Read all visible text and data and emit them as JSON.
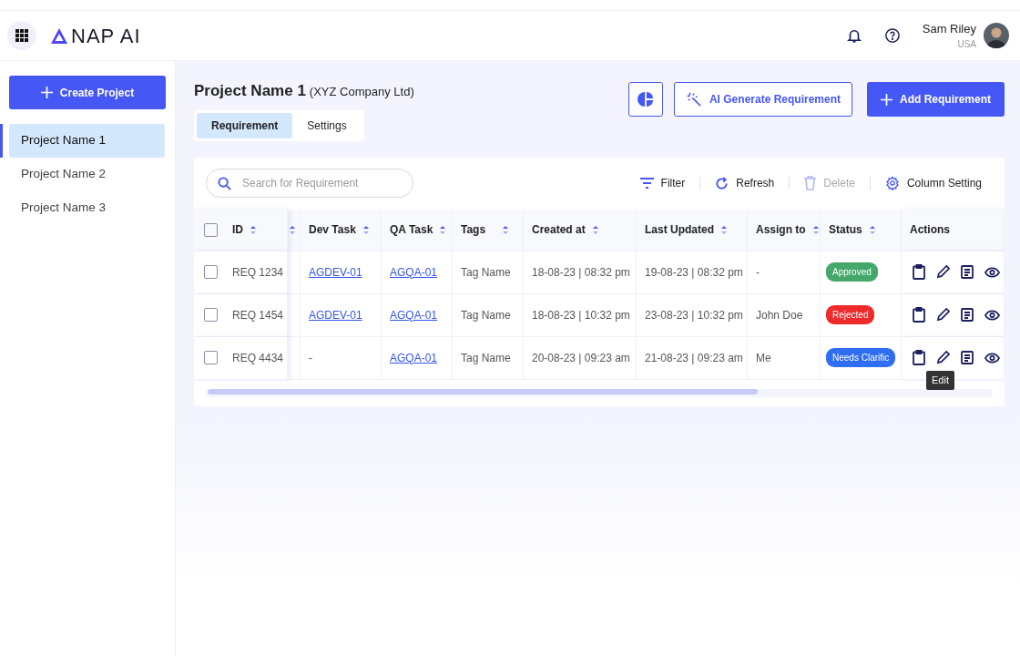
{
  "header": {
    "logo": "NAP AI",
    "user": {
      "name": "Sam Riley",
      "location": "USA"
    }
  },
  "sidebar": {
    "create_button": "Create Project",
    "items": [
      {
        "label": "Project Name 1",
        "selected": true
      },
      {
        "label": "Project Name 2",
        "selected": false
      },
      {
        "label": "Project Name 3",
        "selected": false
      }
    ]
  },
  "project": {
    "title": "Project Name 1",
    "company": "(XYZ Company Ltd)"
  },
  "tabs": [
    {
      "label": "Requirement",
      "selected": true
    },
    {
      "label": "Settings",
      "selected": false
    }
  ],
  "buttons": {
    "ai_generate": "AI Generate Requirement",
    "add": "Add Requirement"
  },
  "toolbar": {
    "search": {
      "placeholder": "Search for Requirement"
    },
    "actions": [
      {
        "kind": "filter",
        "label": "Filter",
        "disabled": false
      },
      {
        "kind": "refresh",
        "label": "Refresh",
        "disabled": false
      },
      {
        "kind": "delete",
        "label": "Delete",
        "disabled": true
      },
      {
        "kind": "settings",
        "label": "Column Setting",
        "disabled": false
      }
    ]
  },
  "table": {
    "select_all_checked": false,
    "columns": [
      {
        "label": "ID",
        "sortable": true
      },
      {
        "sortable": true
      },
      {
        "label": "Dev Task",
        "sortable": true
      },
      {
        "label": "QA Task",
        "sortable": true
      },
      {
        "label": "Tags",
        "sortable": true
      },
      {
        "label": "Created at",
        "sortable": true
      },
      {
        "label": "Last Updated",
        "sortable": true
      },
      {
        "label": "Assign to",
        "sortable": true
      },
      {
        "label": "Status",
        "sortable": true
      },
      {
        "label": "Actions",
        "sortable": false
      }
    ],
    "rows": [
      {
        "checked": false,
        "id": "REQ 1234",
        "dev_task": "AGDEV-01",
        "qa_task": "AGQA-01",
        "tags": "Tag Name",
        "created_at": "18-08-23 | 08:32 pm",
        "last_updated": "19-08-23 | 08:32 pm",
        "assign_to": "-",
        "status": {
          "label": "Approved",
          "color": "#44a86a"
        }
      },
      {
        "checked": false,
        "id": "REQ 1454",
        "dev_task": "AGDEV-01",
        "qa_task": "AGQA-01",
        "tags": "Tag Name",
        "created_at": "18-08-23 | 10:32 pm",
        "last_updated": "23-08-23 | 10:32 pm",
        "assign_to": "John Doe",
        "status": {
          "label": "Rejected",
          "color": "#ee2a2a"
        }
      },
      {
        "checked": false,
        "id": "REQ 4434",
        "dev_task": "-",
        "qa_task": "AGQA-01",
        "tags": "Tag Name",
        "created_at": "20-08-23 | 09:23 am",
        "last_updated": "21-08-23 | 09:23 am",
        "assign_to": "Me",
        "status": {
          "label": "Needs Clarific",
          "color": "#2f6ef0"
        },
        "edit_tooltip": "Edit"
      }
    ]
  }
}
